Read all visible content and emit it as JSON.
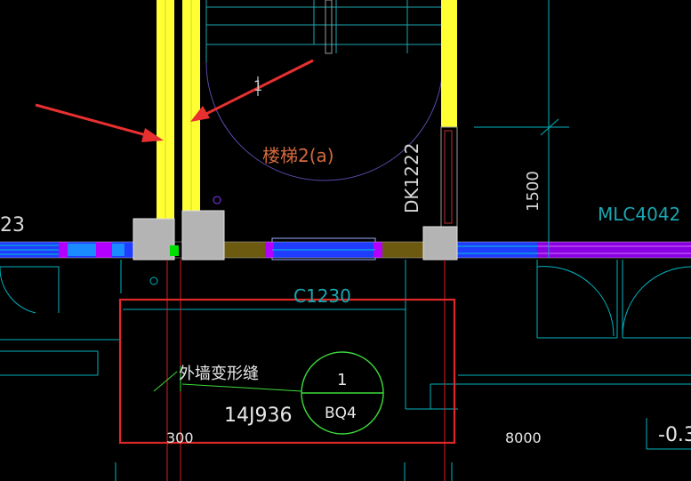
{
  "labels": {
    "stair_number": "1",
    "stair_name": "楼梯2(a)",
    "door_dk": "DK1222",
    "dim_1500": "1500",
    "window_mlc": "MLC4042",
    "partial_23": "23",
    "window_c": "C1230",
    "joint_note": "外墙变形缝",
    "atlas": "14J936",
    "detail_number": "1",
    "detail_code": "BQ4",
    "dim_300": "300",
    "dim_8000": "8000",
    "elevation": "-0.3"
  },
  "colors": {
    "background": "#000000",
    "wall_yellow": "#ffff33",
    "column_gray": "#b4b4b4",
    "cyan_line": "#00c8d2",
    "red_line": "#dc1e1e",
    "magenta": "#b400ff",
    "blue_window": "#1e50ff",
    "highlight_box": "#e02828",
    "detail_green": "#3cdc3c",
    "annotation_red": "#e83030"
  },
  "icons": {
    "arrow_left": "red-arrow-icon",
    "arrow_right": "red-arrow-icon",
    "detail_callout": "detail-callout-circle"
  }
}
